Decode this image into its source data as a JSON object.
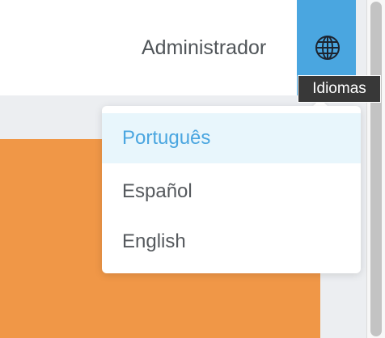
{
  "header": {
    "user_name": "Administrador",
    "language_button_icon": "globe-icon",
    "language_tooltip": "Idiomas"
  },
  "language_menu": {
    "items": [
      {
        "label": "Português",
        "selected": true
      },
      {
        "label": "Español",
        "selected": false
      },
      {
        "label": "English",
        "selected": false
      }
    ]
  },
  "colors": {
    "accent": "#4aa6e0",
    "orange_panel": "#f09747",
    "selected_item_bg": "#e8f6fc",
    "text": "#55595d",
    "tooltip_bg": "#383838"
  }
}
